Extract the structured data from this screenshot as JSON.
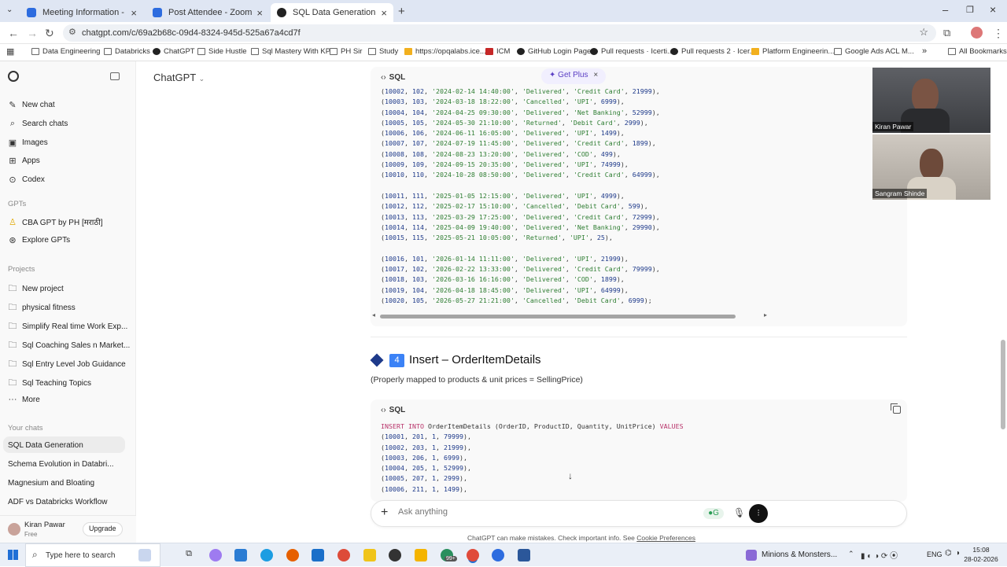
{
  "tabs": [
    {
      "title": "Meeting Information - Zoom",
      "color": "#2d6cdf"
    },
    {
      "title": "Post Attendee - Zoom",
      "color": "#2d6cdf"
    },
    {
      "title": "SQL Data Generation",
      "color": "#222222"
    }
  ],
  "url": "chatgpt.com/c/69a2b68c-09d4-8324-945d-525a67a4cd7f",
  "bookmarks": [
    "Data Engineering",
    "Databricks",
    "ChatGPT",
    "Side Hustle",
    "Sql Mastery With KP",
    "PH Sir",
    "Study",
    "https://opqalabs.ice...",
    "ICM",
    "GitHub Login Page",
    "Pull requests · Icerti...",
    "Pull requests 2 · Icer...",
    "Platform Engineerin...",
    "Google Ads ACL M..."
  ],
  "bookmarks_all": "All Bookmarks",
  "sidebar": {
    "nav": [
      "New chat",
      "Search chats",
      "Images",
      "Apps",
      "Codex"
    ],
    "gpts_header": "GPTs",
    "gpts": [
      "CBA GPT by PH [मराठी]",
      "Explore GPTs"
    ],
    "projects_header": "Projects",
    "projects": [
      "New project",
      "physical fitness",
      "Simplify Real time Work Exp...",
      "Sql Coaching Sales n Market...",
      "Sql Entry Level Job Guidance",
      "Sql Teaching Topics",
      "More"
    ],
    "chats_header": "Your chats",
    "chats": [
      "SQL Data Generation",
      "Schema Evolution in Databri...",
      "Magnesium and Bloating",
      "ADF vs Databricks Workflow"
    ],
    "user_name": "Kiran Pawar",
    "user_plan": "Free",
    "upgrade": "Upgrade"
  },
  "header": {
    "model": "ChatGPT",
    "get_plus": "Get Plus"
  },
  "code1": {
    "lang": "SQL",
    "rows": [
      [
        "10002",
        "102",
        "'2024-02-14 14:40:00'",
        "'Delivered'",
        "'Credit Card'",
        "21999"
      ],
      [
        "10003",
        "103",
        "'2024-03-18 18:22:00'",
        "'Cancelled'",
        "'UPI'",
        "6999"
      ],
      [
        "10004",
        "104",
        "'2024-04-25 09:30:00'",
        "'Delivered'",
        "'Net Banking'",
        "52999"
      ],
      [
        "10005",
        "105",
        "'2024-05-30 21:10:00'",
        "'Returned'",
        "'Debit Card'",
        "2999"
      ],
      [
        "10006",
        "106",
        "'2024-06-11 16:05:00'",
        "'Delivered'",
        "'UPI'",
        "1499"
      ],
      [
        "10007",
        "107",
        "'2024-07-19 11:45:00'",
        "'Delivered'",
        "'Credit Card'",
        "1899"
      ],
      [
        "10008",
        "108",
        "'2024-08-23 13:20:00'",
        "'Delivered'",
        "'COD'",
        "499"
      ],
      [
        "10009",
        "109",
        "'2024-09-15 20:35:00'",
        "'Delivered'",
        "'UPI'",
        "74999"
      ],
      [
        "10010",
        "110",
        "'2024-10-28 08:50:00'",
        "'Delivered'",
        "'Credit Card'",
        "64999"
      ],
      null,
      [
        "10011",
        "111",
        "'2025-01-05 12:15:00'",
        "'Delivered'",
        "'UPI'",
        "4999"
      ],
      [
        "10012",
        "112",
        "'2025-02-17 15:10:00'",
        "'Cancelled'",
        "'Debit Card'",
        "599"
      ],
      [
        "10013",
        "113",
        "'2025-03-29 17:25:00'",
        "'Delivered'",
        "'Credit Card'",
        "72999"
      ],
      [
        "10014",
        "114",
        "'2025-04-09 19:40:00'",
        "'Delivered'",
        "'Net Banking'",
        "29990"
      ],
      [
        "10015",
        "115",
        "'2025-05-21 10:05:00'",
        "'Returned'",
        "'UPI'",
        "25"
      ],
      null,
      [
        "10016",
        "101",
        "'2026-01-14 11:11:00'",
        "'Delivered'",
        "'UPI'",
        "21999"
      ],
      [
        "10017",
        "102",
        "'2026-02-22 13:33:00'",
        "'Delivered'",
        "'Credit Card'",
        "79999"
      ],
      [
        "10018",
        "103",
        "'2026-03-16 16:16:00'",
        "'Delivered'",
        "'COD'",
        "1899"
      ],
      [
        "10019",
        "104",
        "'2026-04-18 18:45:00'",
        "'Delivered'",
        "'UPI'",
        "64999"
      ],
      [
        "10020",
        "105",
        "'2026-05-27 21:21:00'",
        "'Cancelled'",
        "'Debit Card'",
        "6999"
      ]
    ]
  },
  "section": {
    "number": "4",
    "title": "Insert – OrderItemDetails",
    "subtitle": "(Properly mapped to products & unit prices = SellingPrice)"
  },
  "code2": {
    "lang": "SQL",
    "insert_kw": "INSERT INTO",
    "insert_rest": "OrderItemDetails (OrderID, ProductID, Quantity, UnitPrice)",
    "values_kw": "VALUES",
    "rows": [
      [
        "10001",
        "201",
        "1",
        "79999"
      ],
      [
        "10002",
        "203",
        "1",
        "21999"
      ],
      [
        "10003",
        "206",
        "1",
        "6999"
      ],
      [
        "10004",
        "205",
        "1",
        "52999"
      ],
      [
        "10005",
        "207",
        "1",
        "2999"
      ],
      [
        "10006",
        "211",
        "1",
        "1499"
      ]
    ]
  },
  "composer": {
    "placeholder": "Ask anything",
    "disclaimer": "ChatGPT can make mistakes. Check important info. See",
    "cookie_link": "Cookie Preferences"
  },
  "video": [
    {
      "name": "Kiran Pawar"
    },
    {
      "name": "Sangram Shinde"
    }
  ],
  "taskbar": {
    "search_placeholder": "Type here to search",
    "media": "Minions & Monsters...",
    "lang": "ENG",
    "time": "15:08",
    "date": "28-02-2026",
    "badge": "99+"
  }
}
